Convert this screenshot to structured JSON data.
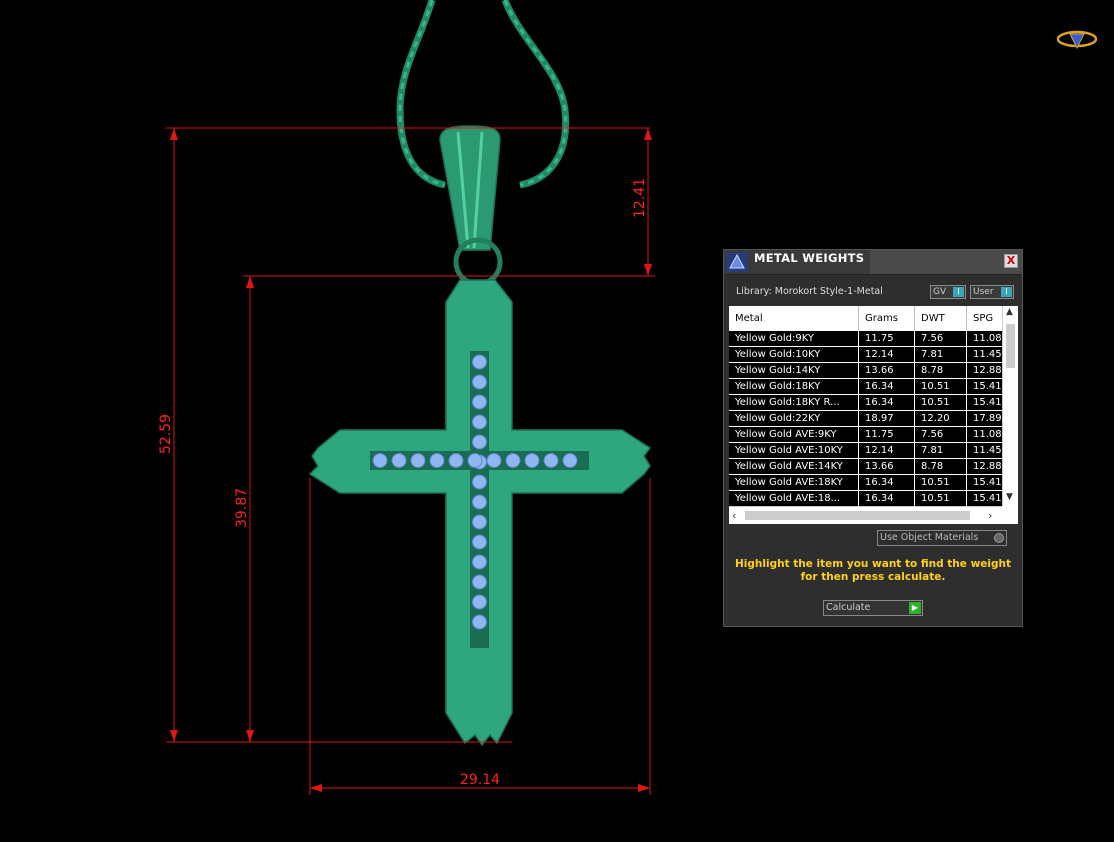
{
  "dimensions": {
    "height_total": "52.59",
    "height_lower": "39.87",
    "bail_height": "12.41",
    "width": "29.14"
  },
  "colors": {
    "dimension_lines": "#e01515",
    "metal_green": "#2fa77e",
    "stone_blue": "#8fb6f0",
    "hint_yellow": "#ffd11a"
  },
  "panel": {
    "title": "METAL WEIGHTS",
    "close_label": "X",
    "library": "Library: Morokort Style-1-Metal",
    "toggles": [
      {
        "label": "GV",
        "knob": "I"
      },
      {
        "label": "User",
        "knob": "I"
      }
    ],
    "columns": [
      "Metal",
      "Grams",
      "DWT",
      "SPG"
    ],
    "rows": [
      [
        "Yellow Gold:9KY",
        "11.75",
        "7.56",
        "11.08"
      ],
      [
        "Yellow Gold:10KY",
        "12.14",
        "7.81",
        "11.45"
      ],
      [
        "Yellow Gold:14KY",
        "13.66",
        "8.78",
        "12.88"
      ],
      [
        "Yellow Gold:18KY",
        "16.34",
        "10.51",
        "15.41"
      ],
      [
        "Yellow Gold:18KY R...",
        "16.34",
        "10.51",
        "15.41"
      ],
      [
        "Yellow Gold:22KY",
        "18.97",
        "12.20",
        "17.89"
      ],
      [
        "Yellow Gold AVE:9KY",
        "11.75",
        "7.56",
        "11.08"
      ],
      [
        "Yellow Gold AVE:10KY",
        "12.14",
        "7.81",
        "11.45"
      ],
      [
        "Yellow Gold AVE:14KY",
        "13.66",
        "8.78",
        "12.88"
      ],
      [
        "Yellow Gold AVE:18KY",
        "16.34",
        "10.51",
        "15.41"
      ],
      [
        "Yellow Gold AVE:18...",
        "16.34",
        "10.51",
        "15.41"
      ]
    ],
    "use_object_materials": "Use Object Materials",
    "hint": "Highlight the item you want to find the weight for then press calculate.",
    "calculate_label": "Calculate"
  }
}
